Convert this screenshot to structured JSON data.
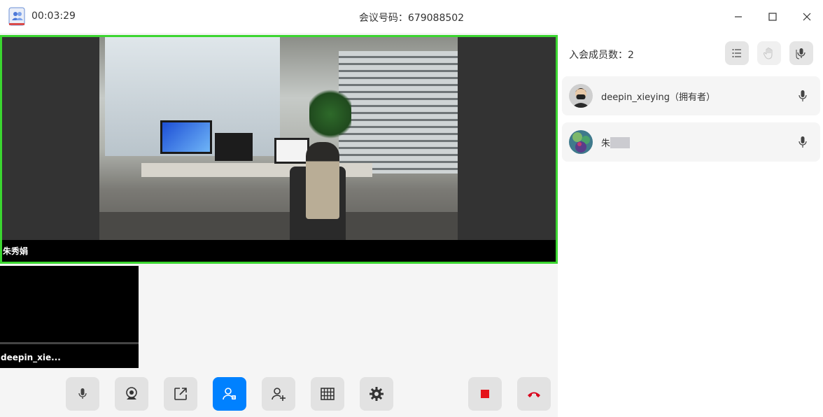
{
  "titlebar": {
    "timer": "00:03:29",
    "meeting_id_label": "会议号码：",
    "meeting_id": "679088502"
  },
  "main": {
    "active_speaker": "朱秀娟",
    "thumbnail_name": "deepin_xie..."
  },
  "toolbar": {
    "items": [
      {
        "name": "microphone",
        "icon": "microphone-icon"
      },
      {
        "name": "camera",
        "icon": "webcam-icon"
      },
      {
        "name": "share-screen",
        "icon": "share-icon"
      },
      {
        "name": "members",
        "icon": "members-icon",
        "active": true
      },
      {
        "name": "invite",
        "icon": "add-user-icon"
      },
      {
        "name": "layout",
        "icon": "grid-icon"
      },
      {
        "name": "settings",
        "icon": "gear-icon"
      },
      {
        "name": "stop-recording",
        "icon": "stop-icon"
      },
      {
        "name": "hang-up",
        "icon": "hangup-icon"
      }
    ]
  },
  "panel": {
    "member_count_label": "入会成员数：",
    "member_count": "2",
    "members": [
      {
        "name": "deepin_xieying（拥有者）",
        "mic": "microphone-icon"
      },
      {
        "name": "朱",
        "mic": "microphone-icon",
        "name_partially_hidden": true
      }
    ]
  },
  "colors": {
    "active_speaker_border": "#3bd630",
    "accent": "#0081ff",
    "stop": "#e5141b",
    "hangup": "#d9001b"
  }
}
